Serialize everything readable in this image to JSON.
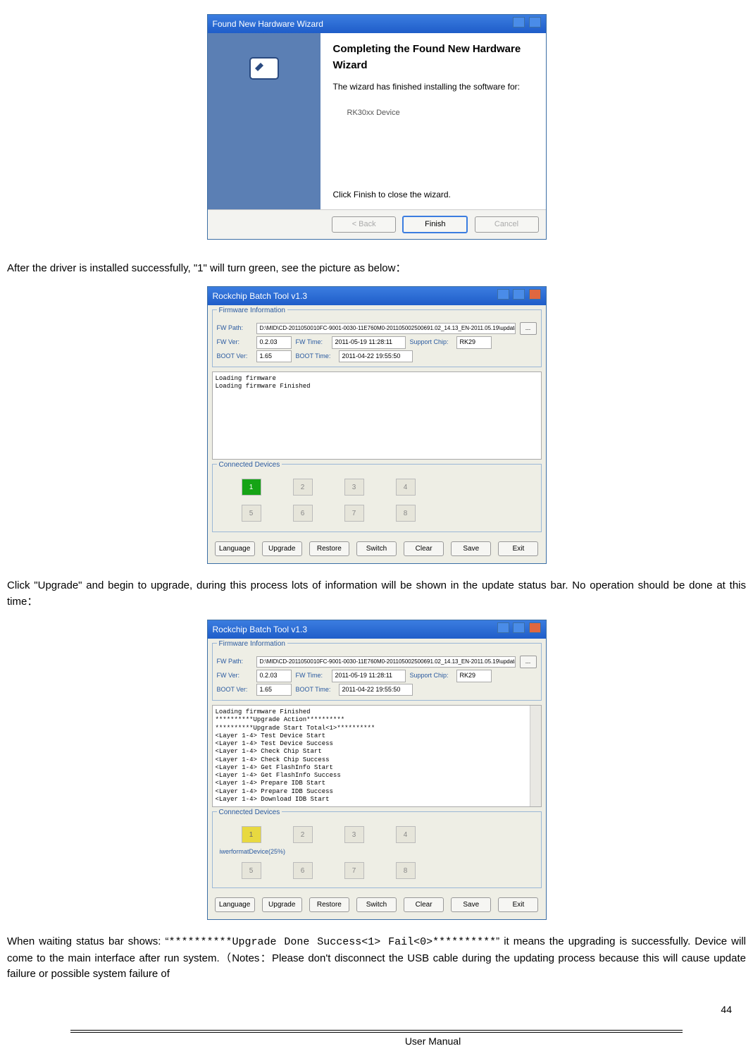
{
  "wizard": {
    "title": "Found New Hardware Wizard",
    "heading": "Completing the Found New Hardware Wizard",
    "sub": "The wizard has finished installing the software for:",
    "device": "RK30xx Device",
    "closeline": "Click Finish to close the wizard.",
    "back": "< Back",
    "finish": "Finish",
    "cancel": "Cancel"
  },
  "p1": "After the driver is installed successfully, \"1\" will turn green, see the picture as below：",
  "tool1": {
    "title": "Rockchip Batch Tool v1.3",
    "group_fw": "Firmware Information",
    "fwpath_l": "FW Path:",
    "fwpath_v": "D:\\MID\\CD-2011050010FC-9001-0030-11E760M0-201105002500691.02_14.13_EN-2011.05.19\\update.i",
    "fwver_l": "FW Ver:",
    "fwver_v": "0.2.03",
    "fwtime_l": "FW Time:",
    "fwtime_v": "2011-05-19 11:28:11",
    "chip_l": "Support Chip:",
    "chip_v": "RK29",
    "bootver_l": "BOOT Ver:",
    "bootver_v": "1.65",
    "boottime_l": "BOOT Time:",
    "boottime_v": "2011-04-22 19:55:50",
    "log_lines": "Loading firmware\nLoading firmware Finished",
    "group_dev": "Connected Devices",
    "slots": [
      "1",
      "2",
      "3",
      "4",
      "5",
      "6",
      "7",
      "8"
    ],
    "btns": [
      "Language",
      "Upgrade",
      "Restore",
      "Switch",
      "Clear",
      "Save",
      "Exit"
    ]
  },
  "p2": "Click \"Upgrade\" and begin to upgrade, during this process lots of information will be shown in the update status bar. No operation should be done at this time：",
  "tool2": {
    "title": "Rockchip Batch Tool v1.3",
    "log_lines": "Loading firmware Finished\n**********Upgrade Action**********\n**********Upgrade Start Total<1>**********\n<Layer 1-4> Test Device Start\n<Layer 1-4> Test Device Success\n<Layer 1-4> Check Chip Start\n<Layer 1-4> Check Chip Success\n<Layer 1-4> Get FlashInfo Start\n<Layer 1-4> Get FlashInfo Success\n<Layer 1-4> Prepare IDB Start\n<Layer 1-4> Prepare IDB Success\n<Layer 1-4> Download IDB Start",
    "overlay": "iwerformatDevice(25%)"
  },
  "p3_a": "When waiting status bar shows: ",
  "p3_code": "**********Upgrade Done Success<1> Fail<0>**********",
  "p3_b": "it means the upgrading is successfully. Device will come to the main interface after run system.（Notes：Please don't disconnect the USB cable during the updating process because this will cause update failure or possible system failure of",
  "footer": {
    "um": "User Manual",
    "pg": "44"
  }
}
